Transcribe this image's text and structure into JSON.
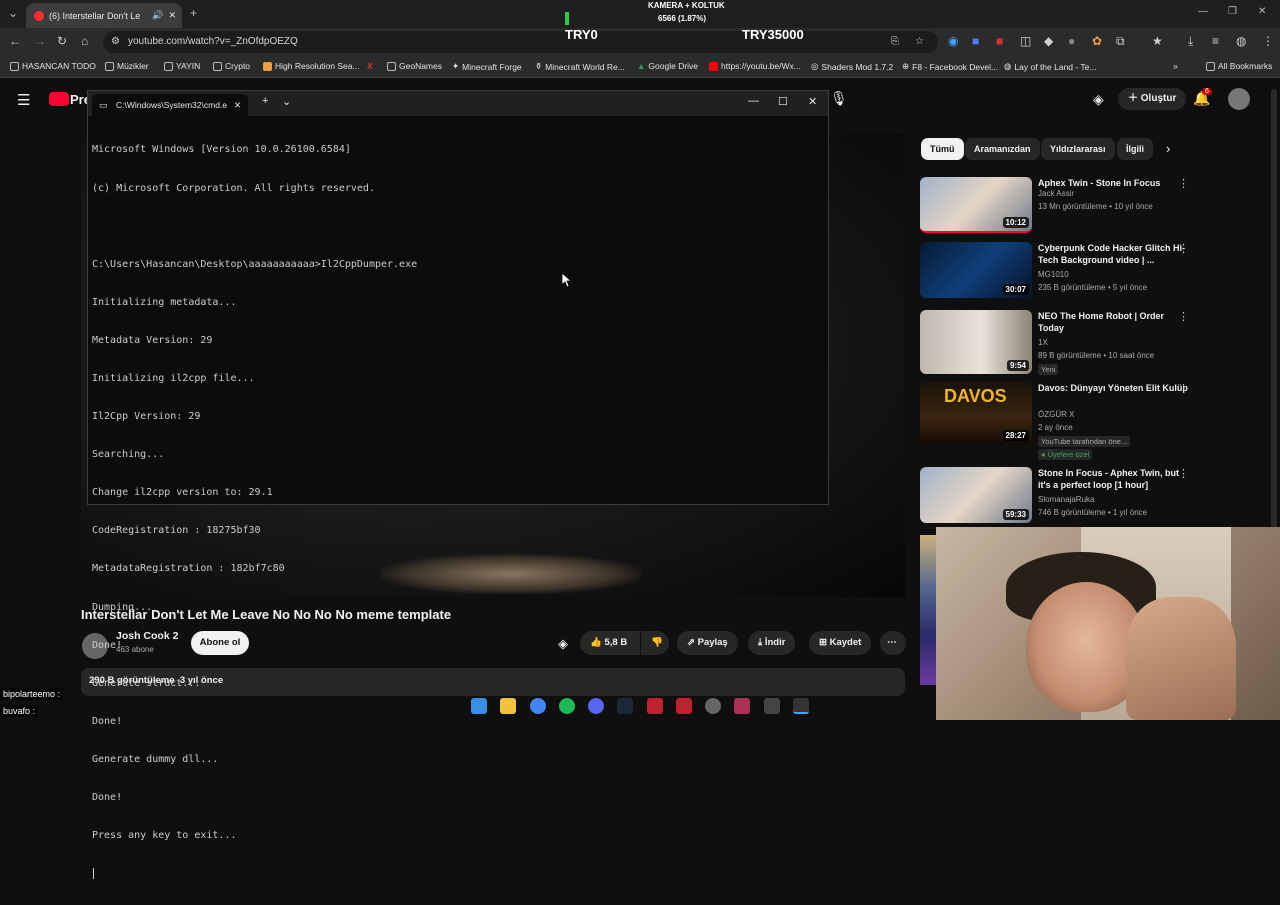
{
  "browser": {
    "tab_title": "(6) Interstellar Don't Let Me Leave No No No No meme template",
    "tab_title_short": "(6) Interstellar Don't Le",
    "url": "youtube.com/watch?v=_ZnOfdpOEZQ",
    "bookmarks": [
      "HASANCAN TODO",
      "Müzikler",
      "YAYIN",
      "Crypto",
      "High Resolution Sea...",
      "GeoNames",
      "Minecraft Forge",
      "Minecraft World Re...",
      "Google Drive",
      "https://youtu.be/Wx...",
      "Shaders Mod 1.7.2",
      "F8 - Facebook Devel...",
      "Lay of the Land - Te..."
    ],
    "all_bookmarks": "All Bookmarks"
  },
  "overlay": {
    "header": "KAMERA + KOLTUK",
    "progress": "6566 (1.87%)",
    "left": "TRY0",
    "right": "TRY35000",
    "progress_fraction": 0.0187
  },
  "cmd": {
    "title": "C:\\Windows\\System32\\cmd.e",
    "lines": [
      "Microsoft Windows [Version 10.0.26100.6584]",
      "(c) Microsoft Corporation. All rights reserved.",
      "",
      "C:\\Users\\Hasancan\\Desktop\\aaaaaaaaaaa>Il2CppDumper.exe",
      "Initializing metadata...",
      "Metadata Version: 29",
      "Initializing il2cpp file...",
      "Il2Cpp Version: 29",
      "Searching...",
      "Change il2cpp version to: 29.1",
      "CodeRegistration : 18275bf30",
      "MetadataRegistration : 182bf7c80",
      "Dumping...",
      "Done!",
      "Generate struct...",
      "Done!",
      "Generate dummy dll...",
      "Done!",
      "Press any key to exit..."
    ]
  },
  "youtube": {
    "logo_partial": "Pre",
    "create_label": "Oluştur",
    "notification_count": "6",
    "video_title": "Interstellar Don't Let Me Leave No No No No meme template",
    "channel": "Josh Cook 2",
    "subscribers": "463 abone",
    "subscribe_label": "Abone ol",
    "likes": "5,8 B",
    "share": "Paylaş",
    "download": "İndir",
    "save": "Kaydet",
    "views": "290 B görüntüleme",
    "age": "3 yıl önce",
    "chips": [
      "Tümü",
      "Aramanızdan",
      "Yıldızlararası",
      "İlgili"
    ],
    "recommendations": [
      {
        "title": "Aphex Twin - Stone In Focus",
        "channel": "Jack Assir",
        "meta": "13 Mn görüntüleme • 10 yıl önce",
        "duration": "10:12"
      },
      {
        "title": "Cyberpunk Code Hacker Glitch Hi-Tech Background video | ...",
        "channel": "MG1010",
        "meta": "235 B görüntüleme • 5 yıl önce",
        "duration": "30:07"
      },
      {
        "title": "NEO The Home Robot | Order Today",
        "channel": "1X",
        "meta": "89 B görüntüleme • 10 saat önce",
        "badge": "Yeni",
        "duration": "9:54"
      },
      {
        "title": "Davos: Dünyayı Yöneten Elit Kulüp",
        "channel": "ÖZGÜR X",
        "meta": "2 ay önce",
        "badge": "YouTube tarafından öne...",
        "badge2": "Üyelere özel",
        "duration": "28:27",
        "thumb_text": "DAVOS"
      },
      {
        "title": "Stone In Focus - Aphex Twin, but it's a perfect loop [1 hour]",
        "channel": "SlomanajaRuka",
        "meta": "746 B görüntüleme • 1 yıl önce",
        "duration": "59:33"
      }
    ]
  },
  "chat": [
    {
      "user": "bipolarteemo",
      "sep": ":"
    },
    {
      "user": "buvafo",
      "sep": ":"
    }
  ],
  "colors": {
    "yt_red": "#ff0033",
    "chrome_dark": "#2b2b2b",
    "cmd_bg": "#0c0c0c",
    "overlay_green": "#2ecc40"
  }
}
